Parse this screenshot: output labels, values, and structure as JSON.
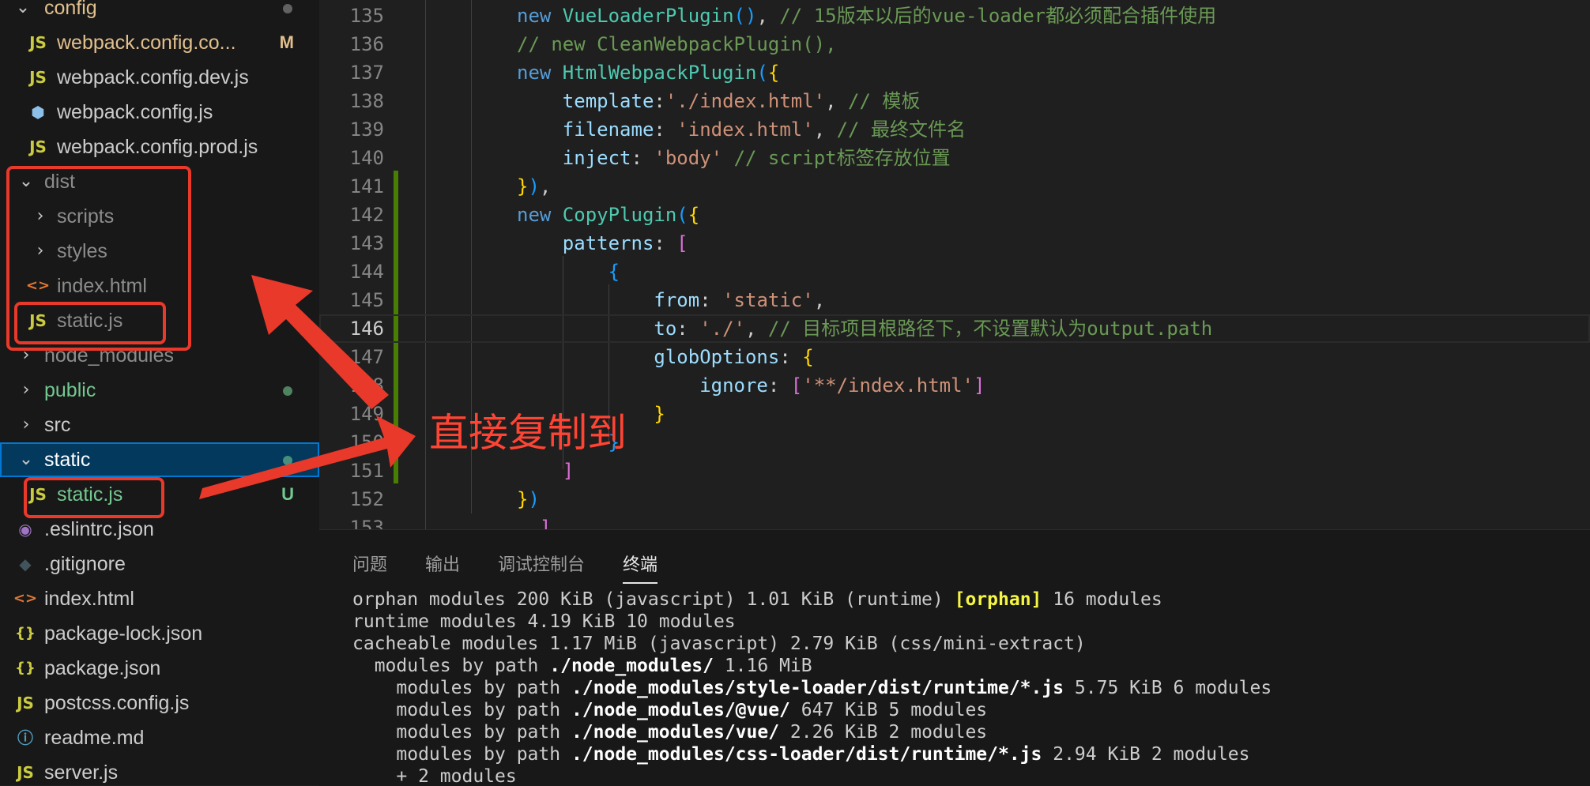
{
  "explorer": {
    "items": [
      {
        "label": "config",
        "badge": ""
      },
      {
        "label": "webpack.config.co...",
        "badge": "M"
      },
      {
        "label": "webpack.config.dev.js",
        "badge": ""
      },
      {
        "label": "webpack.config.js",
        "badge": ""
      },
      {
        "label": "webpack.config.prod.js",
        "badge": ""
      },
      {
        "label": "dist",
        "badge": ""
      },
      {
        "label": "scripts",
        "badge": ""
      },
      {
        "label": "styles",
        "badge": ""
      },
      {
        "label": "index.html",
        "badge": ""
      },
      {
        "label": "static.js",
        "badge": ""
      },
      {
        "label": "node_modules",
        "badge": ""
      },
      {
        "label": "public",
        "badge": ""
      },
      {
        "label": "src",
        "badge": ""
      },
      {
        "label": "static",
        "badge": ""
      },
      {
        "label": "static.js",
        "badge": "U"
      },
      {
        "label": ".eslintrc.json",
        "badge": ""
      },
      {
        "label": ".gitignore",
        "badge": ""
      },
      {
        "label": "index.html",
        "badge": ""
      },
      {
        "label": "package-lock.json",
        "badge": ""
      },
      {
        "label": "package.json",
        "badge": ""
      },
      {
        "label": "postcss.config.js",
        "badge": ""
      },
      {
        "label": "readme.md",
        "badge": ""
      },
      {
        "label": "server.js",
        "badge": ""
      }
    ]
  },
  "editor": {
    "active_line": "146",
    "lines": [
      {
        "n": "135",
        "tokens": [
          [
            "kw",
            "new "
          ],
          [
            "cls",
            "VueLoaderPlugin"
          ],
          [
            "b3",
            "()"
          ],
          [
            "pl",
            ", "
          ],
          [
            "cm",
            "// 15版本以后的vue-loader都必须配合插件使用"
          ]
        ]
      },
      {
        "n": "136",
        "tokens": [
          [
            "cm",
            "// new CleanWebpackPlugin(),"
          ]
        ]
      },
      {
        "n": "137",
        "tokens": [
          [
            "kw",
            "new "
          ],
          [
            "cls",
            "HtmlWebpackPlugin"
          ],
          [
            "b3",
            "("
          ],
          [
            "b1",
            "{"
          ]
        ]
      },
      {
        "n": "138",
        "tokens": [
          [
            "pl",
            "    "
          ],
          [
            "prop",
            "template"
          ],
          [
            "pl",
            ":"
          ],
          [
            "str",
            "'./index.html'"
          ],
          [
            "pl",
            ", "
          ],
          [
            "cm",
            "// 模板"
          ]
        ]
      },
      {
        "n": "139",
        "tokens": [
          [
            "pl",
            "    "
          ],
          [
            "prop",
            "filename"
          ],
          [
            "pl",
            ": "
          ],
          [
            "str",
            "'index.html'"
          ],
          [
            "pl",
            ", "
          ],
          [
            "cm",
            "// 最终文件名"
          ]
        ]
      },
      {
        "n": "140",
        "tokens": [
          [
            "pl",
            "    "
          ],
          [
            "prop",
            "inject"
          ],
          [
            "pl",
            ": "
          ],
          [
            "str",
            "'body'"
          ],
          [
            "pl",
            " "
          ],
          [
            "cm",
            "// script标签存放位置"
          ]
        ]
      },
      {
        "n": "141",
        "tokens": [
          [
            "b1",
            "}"
          ],
          [
            "b3",
            ")"
          ],
          [
            "pl",
            ","
          ]
        ]
      },
      {
        "n": "142",
        "tokens": [
          [
            "kw",
            "new "
          ],
          [
            "cls",
            "CopyPlugin"
          ],
          [
            "b3",
            "("
          ],
          [
            "b1",
            "{"
          ]
        ]
      },
      {
        "n": "143",
        "tokens": [
          [
            "pl",
            "    "
          ],
          [
            "prop",
            "patterns"
          ],
          [
            "pl",
            ": "
          ],
          [
            "b2",
            "["
          ]
        ]
      },
      {
        "n": "144",
        "tokens": [
          [
            "pl",
            "        "
          ],
          [
            "b3",
            "{"
          ]
        ]
      },
      {
        "n": "145",
        "tokens": [
          [
            "pl",
            "            "
          ],
          [
            "prop",
            "from"
          ],
          [
            "pl",
            ": "
          ],
          [
            "str",
            "'static'"
          ],
          [
            "pl",
            ","
          ]
        ]
      },
      {
        "n": "146",
        "tokens": [
          [
            "pl",
            "            "
          ],
          [
            "prop",
            "to"
          ],
          [
            "pl",
            ": "
          ],
          [
            "str",
            "'./'"
          ],
          [
            "pl",
            ", "
          ],
          [
            "cm",
            "// 目标项目根路径下，不设置默认为output.path"
          ]
        ]
      },
      {
        "n": "147",
        "tokens": [
          [
            "pl",
            "            "
          ],
          [
            "prop",
            "globOptions"
          ],
          [
            "pl",
            ": "
          ],
          [
            "b1",
            "{"
          ]
        ]
      },
      {
        "n": "148",
        "tokens": [
          [
            "pl",
            "                "
          ],
          [
            "prop",
            "ignore"
          ],
          [
            "pl",
            ": "
          ],
          [
            "b2",
            "["
          ],
          [
            "str",
            "'**/index.html'"
          ],
          [
            "b2",
            "]"
          ]
        ]
      },
      {
        "n": "149",
        "tokens": [
          [
            "pl",
            "            "
          ],
          [
            "b1",
            "}"
          ]
        ]
      },
      {
        "n": "150",
        "tokens": [
          [
            "pl",
            "        "
          ],
          [
            "b3",
            "}"
          ]
        ]
      },
      {
        "n": "151",
        "tokens": [
          [
            "pl",
            "    "
          ],
          [
            "b2",
            "]"
          ]
        ]
      },
      {
        "n": "152",
        "tokens": [
          [
            "b1",
            "}"
          ],
          [
            "b3",
            ")"
          ]
        ]
      },
      {
        "n": "153",
        "tokens": [
          [
            "pl",
            "  "
          ],
          [
            "b2",
            "]"
          ]
        ]
      }
    ]
  },
  "panel": {
    "tabs": [
      "问题",
      "输出",
      "调试控制台",
      "终端"
    ],
    "active_tab": "终端",
    "terminal_lines": [
      [
        [
          "t",
          "orphan modules 200 KiB (javascript) 1.01 KiB (runtime) "
        ],
        [
          "y",
          "[orphan]"
        ],
        [
          "t",
          " 16 modules"
        ]
      ],
      [
        [
          "t",
          "runtime modules 4.19 KiB 10 modules"
        ]
      ],
      [
        [
          "t",
          "cacheable modules 1.17 MiB (javascript) 2.79 KiB (css/mini-extract)"
        ]
      ],
      [
        [
          "t",
          "  modules by path "
        ],
        [
          "b",
          "./node_modules/"
        ],
        [
          "t",
          " 1.16 MiB"
        ]
      ],
      [
        [
          "t",
          "    modules by path "
        ],
        [
          "b",
          "./node_modules/style-loader/dist/runtime/*.js"
        ],
        [
          "t",
          " 5.75 KiB 6 modules"
        ]
      ],
      [
        [
          "t",
          "    modules by path "
        ],
        [
          "b",
          "./node_modules/@vue/"
        ],
        [
          "t",
          " 647 KiB 5 modules"
        ]
      ],
      [
        [
          "t",
          "    modules by path "
        ],
        [
          "b",
          "./node_modules/vue/"
        ],
        [
          "t",
          " 2.26 KiB 2 modules"
        ]
      ],
      [
        [
          "t",
          "    modules by path "
        ],
        [
          "b",
          "./node_modules/css-loader/dist/runtime/*.js"
        ],
        [
          "t",
          " 2.94 KiB 2 modules"
        ]
      ],
      [
        [
          "t",
          "    + 2 modules"
        ]
      ]
    ]
  },
  "annotation": {
    "text": "直接复制到"
  },
  "colors": {
    "accent": "#0078d4",
    "annotation_red": "#e8392a",
    "modified": "#e2c08d",
    "untracked": "#73c991"
  }
}
